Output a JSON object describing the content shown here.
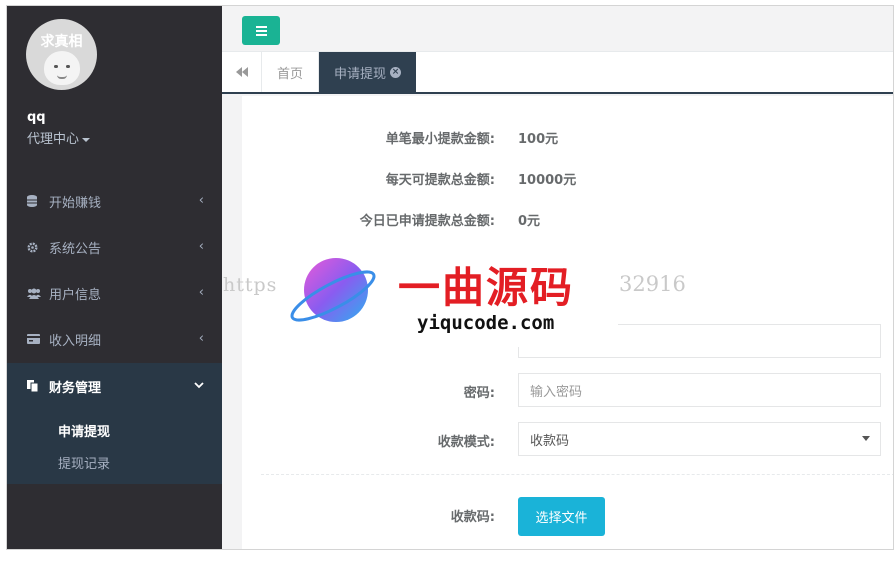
{
  "sidebar": {
    "avatar_text": "求真相",
    "user_name": "qq",
    "user_role": "代理中心",
    "nav": [
      {
        "label": "开始赚钱",
        "icon": "database-icon"
      },
      {
        "label": "系统公告",
        "icon": "gear-icon"
      },
      {
        "label": "用户信息",
        "icon": "users-icon"
      },
      {
        "label": "收入明细",
        "icon": "card-icon"
      }
    ],
    "group": {
      "label": "财务管理",
      "icon": "copy-icon",
      "items": [
        "申请提现",
        "提现记录"
      ]
    }
  },
  "tabs": {
    "home": "首页",
    "active": "申请提现"
  },
  "form": {
    "min_label": "单笔最小提款金额:",
    "min_value": "100元",
    "daily_label": "每天可提款总金额:",
    "daily_value": "10000元",
    "today_label": "今日已申请提款总金额:",
    "today_value": "0元",
    "password_label": "密码:",
    "password_placeholder": "输入密码",
    "mode_label": "收款模式:",
    "mode_value": "收款码",
    "qr_label": "收款码:",
    "file_button": "选择文件"
  },
  "watermark": {
    "title": "一曲源码",
    "domain": "yiqucode.com",
    "url_left": "https",
    "url_right": "32916"
  },
  "colors": {
    "sidebar_bg": "#2e2d32",
    "accent_green": "#1ab394",
    "file_button": "#1ab3d8",
    "active_tab": "#2f4050"
  }
}
